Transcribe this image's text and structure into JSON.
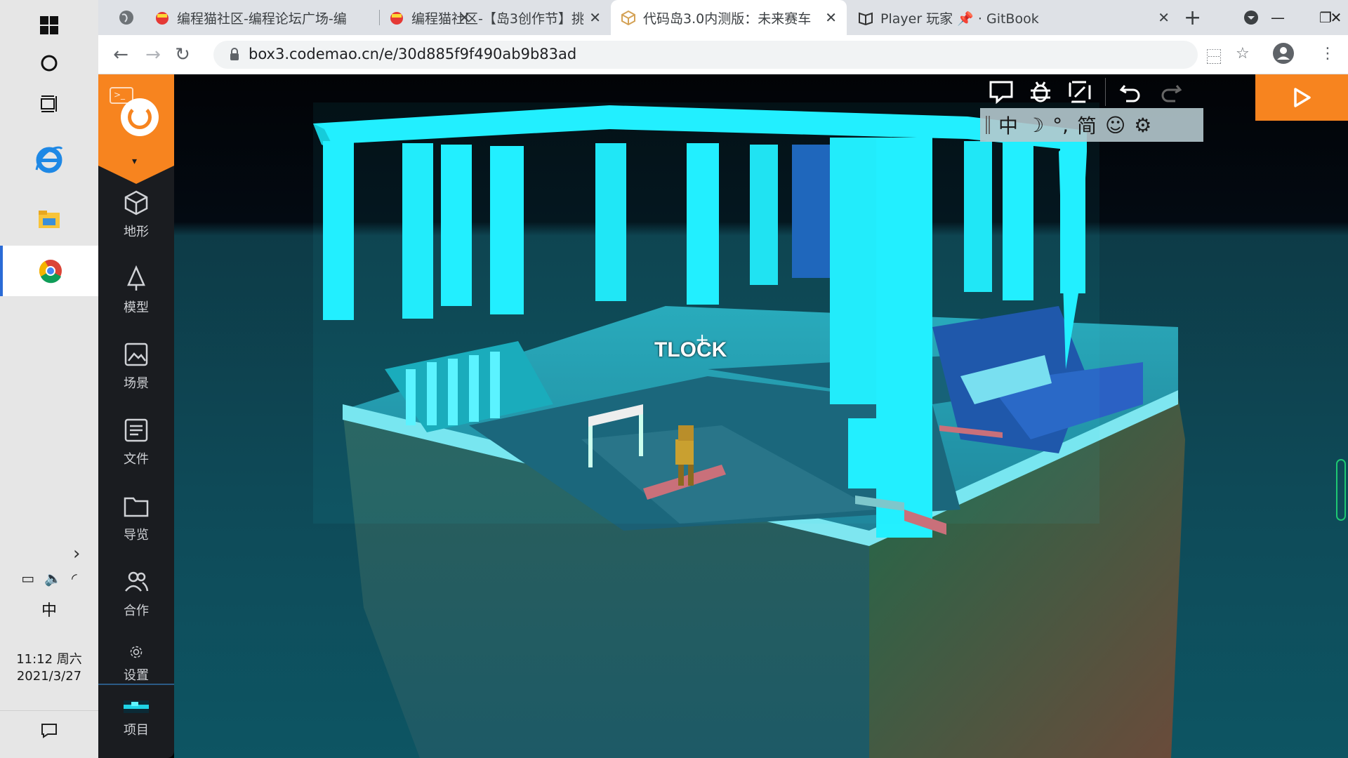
{
  "taskbar": {
    "ime": "中",
    "time": "11:12 周六",
    "date": "2021/3/27"
  },
  "browser": {
    "tabs": [
      {
        "title": "编程猫社区-编程论坛广场-编",
        "active": false
      },
      {
        "title": "编程猫社区-【岛3创作节】挑",
        "active": false
      },
      {
        "title": "代码岛3.0内测版：未来赛车",
        "active": true
      },
      {
        "title": "Player 玩家 📌 · GitBook",
        "active": false
      }
    ],
    "new_tab": "+",
    "url": "box3.codemao.cn/e/30d885f9f490ab9b83ad"
  },
  "editor": {
    "sidebar": [
      {
        "label": "地形",
        "icon": "cube-icon"
      },
      {
        "label": "模型",
        "icon": "tree-icon"
      },
      {
        "label": "场景",
        "icon": "picture-icon"
      },
      {
        "label": "文件",
        "icon": "list-icon"
      },
      {
        "label": "导览",
        "icon": "folder-icon"
      },
      {
        "label": "合作",
        "icon": "users-icon"
      },
      {
        "label": "设置",
        "icon": "gear-icon"
      },
      {
        "label": "项目",
        "icon": "project-thumbnail"
      }
    ],
    "ime_bar": [
      "中",
      "☽",
      "°,",
      "简",
      "☺",
      "⚙"
    ],
    "player_name": "TLOCK"
  },
  "colors": {
    "accent": "#f7841f",
    "pillar": "#23f0ff",
    "sidebar": "#1a1c20"
  }
}
